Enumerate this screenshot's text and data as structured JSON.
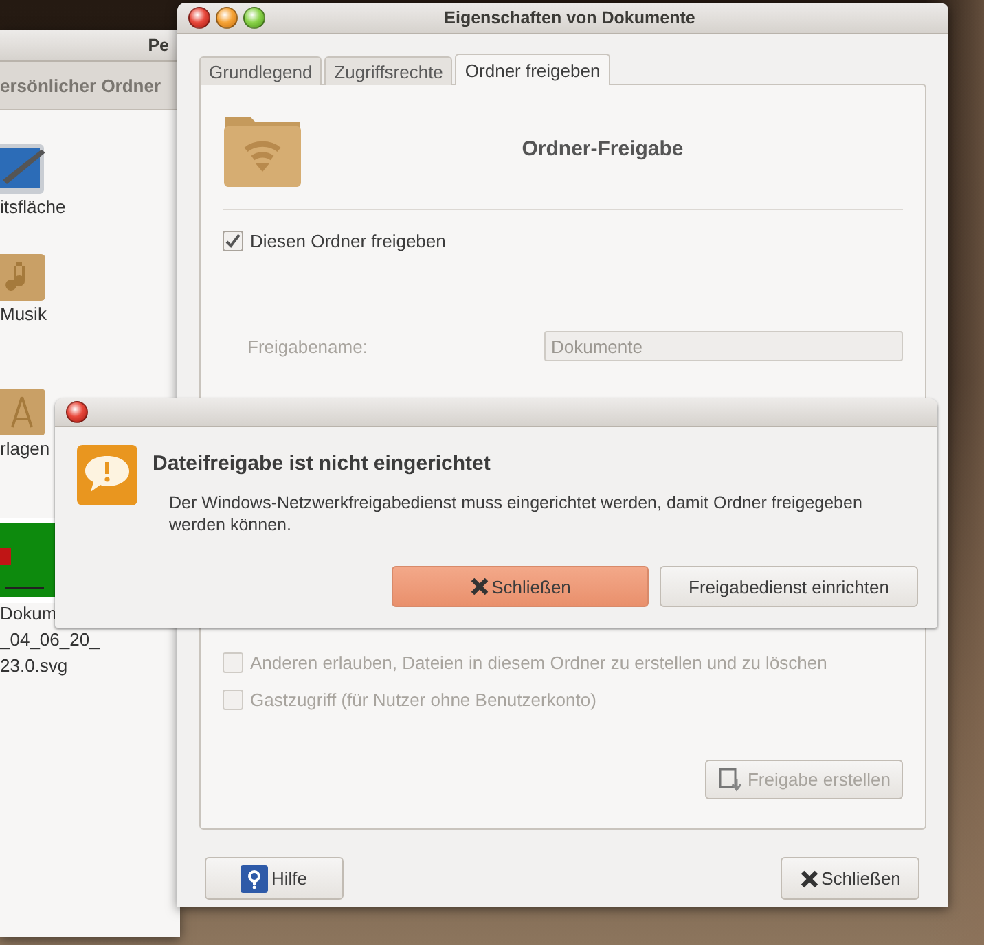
{
  "file_manager": {
    "title": "Pe",
    "location": "ersönlicher Ordner",
    "items": [
      {
        "kind": "desktop",
        "lines": [
          "itsfläche"
        ]
      },
      {
        "kind": "music",
        "lines": [
          "Musik"
        ]
      },
      {
        "kind": "templates",
        "lines": [
          "rlagen"
        ]
      },
      {
        "lines": [
          "Dokum",
          "_04_06_20_",
          "23.0.svg"
        ]
      }
    ]
  },
  "properties_window": {
    "title": "Eigenschaften von Dokumente",
    "tabs": [
      {
        "label": "Grundlegend",
        "selected": false
      },
      {
        "label": "Zugriffsrechte",
        "selected": false
      },
      {
        "label": "Ordner freigeben",
        "selected": true
      }
    ],
    "heading": "Ordner-Freigabe",
    "share_checkbox": {
      "label": "Diesen Ordner freigeben",
      "checked": true
    },
    "share_name": {
      "label": "Freigabename:",
      "value": "Dokumente",
      "disabled": true
    },
    "options": [
      {
        "label": "Anderen erlauben, Dateien in diesem Ordner zu erstellen und zu löschen",
        "checked": false,
        "disabled": true
      },
      {
        "label": "Gastzugriff (für Nutzer ohne Benutzerkonto)",
        "checked": false,
        "disabled": true
      }
    ],
    "create_button": {
      "label": "Freigabe erstellen",
      "disabled": true
    },
    "help_button": "Hilfe",
    "close_button": "Schließen"
  },
  "dialog": {
    "title": "Dateifreigabe ist nicht eingerichtet",
    "message": "Der Windows-Netzwerkfreigabedienst muss eingerichtet werden, damit Ordner freigegeben werden können.",
    "buttons": [
      {
        "label": "Schließen",
        "kind": "close",
        "default": true
      },
      {
        "label": "Freigabedienst einrichten",
        "kind": "plain",
        "default": false
      }
    ]
  }
}
